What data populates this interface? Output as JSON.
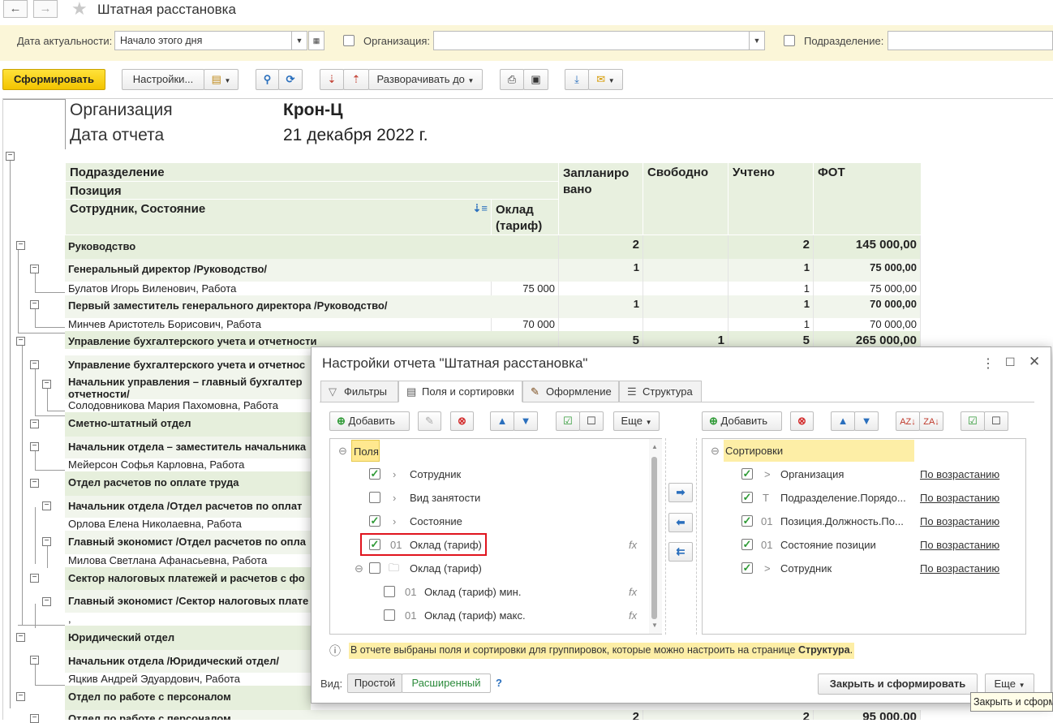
{
  "window": {
    "title": "Штатная расстановка"
  },
  "filters": {
    "date_label": "Дата актуальности:",
    "date_value": "Начало этого дня",
    "org_label": "Организация:",
    "org_value": "",
    "dept_label": "Подразделение:",
    "dept_value": ""
  },
  "toolbar": {
    "generate": "Сформировать",
    "settings": "Настройки...",
    "expand_to": "Разворачивать до"
  },
  "report": {
    "org_label": "Организация",
    "org_value": "Крон-Ц",
    "date_label": "Дата отчета",
    "date_value": "21 декабря 2022 г.",
    "headers": {
      "dept": "Подразделение",
      "position": "Позиция",
      "employee": "Сотрудник, Состояние",
      "salary": "Оклад (тариф)",
      "planned": "Запланиро вано",
      "free": "Свободно",
      "counted": "Учтено",
      "fot": "ФОТ"
    },
    "rows": [
      {
        "name": "Руководство",
        "salary": "",
        "planned": "2",
        "free": "",
        "counted": "2",
        "fot": "145 000,00"
      },
      {
        "name": "Генеральный директор /Руководство/",
        "salary": "",
        "planned": "1",
        "free": "",
        "counted": "1",
        "fot": "75 000,00"
      },
      {
        "name": "Булатов Игорь Виленович, Работа",
        "salary": "75 000",
        "planned": "",
        "free": "",
        "counted": "1",
        "fot": "75 000,00"
      },
      {
        "name": "Первый заместитель генерального директора /Руководство/",
        "salary": "",
        "planned": "1",
        "free": "",
        "counted": "1",
        "fot": "70 000,00"
      },
      {
        "name": "Минчев Аристотель Борисович, Работа",
        "salary": "70 000",
        "planned": "",
        "free": "",
        "counted": "1",
        "fot": "70 000,00"
      },
      {
        "name": "Управление бухгалтерского учета и отчетности",
        "salary": "",
        "planned": "5",
        "free": "1",
        "counted": "5",
        "fot": "265 000,00"
      },
      {
        "name": "Управление бухгалтерского учета и отчетнос"
      },
      {
        "name": "Начальник управления – главный бухгалтер",
        "name2": "отчетности/"
      },
      {
        "name": "Солодовникова Мария Пахомовна, Работа"
      },
      {
        "name": "Сметно-штатный отдел"
      },
      {
        "name": "Начальник отдела – заместитель начальника"
      },
      {
        "name": "Мейерсон Софья Карловна, Работа"
      },
      {
        "name": "Отдел расчетов по оплате труда"
      },
      {
        "name": "Начальник отдела /Отдел расчетов по оплат"
      },
      {
        "name": "Орлова Елена Николаевна, Работа"
      },
      {
        "name": "Главный экономист /Отдел расчетов по опла"
      },
      {
        "name": "Милова Светлана Афанасьевна, Работа"
      },
      {
        "name": "Сектор налоговых платежей и расчетов с фо"
      },
      {
        "name": "Главный экономист /Сектор налоговых плате"
      },
      {
        "name": ","
      },
      {
        "name": "Юридический отдел"
      },
      {
        "name": "Начальник отдела /Юридический отдел/"
      },
      {
        "name": "Яцкив Андрей Эдуардович, Работа"
      },
      {
        "name": "Отдел по работе с персоналом"
      },
      {
        "name": "Отдел по работе с персоналом",
        "salary": "",
        "planned": "2",
        "free": "",
        "counted": "2",
        "fot": "95 000,00"
      }
    ]
  },
  "dialog": {
    "title": "Настройки отчета \"Штатная расстановка\"",
    "tabs": [
      "Фильтры",
      "Поля и сортировки",
      "Оформление",
      "Структура"
    ],
    "left": {
      "add": "Добавить",
      "more": "Еще",
      "root": "Поля",
      "items": [
        {
          "prefix": ">",
          "label": "Сотрудник",
          "checked": true
        },
        {
          "prefix": ">",
          "label": "Вид занятости",
          "checked": false
        },
        {
          "prefix": ">",
          "label": "Состояние",
          "checked": true
        },
        {
          "prefix": "01",
          "label": "Оклад (тариф)",
          "checked": true
        },
        {
          "prefix": "",
          "label": "Оклад (тариф)",
          "checked": false
        },
        {
          "prefix": "01",
          "label": "Оклад (тариф) мин.",
          "checked": false
        },
        {
          "prefix": "01",
          "label": "Оклад (тариф) макс.",
          "checked": false
        }
      ]
    },
    "right": {
      "add": "Добавить",
      "root": "Сортировки",
      "items": [
        {
          "prefix": ">",
          "label": "Организация",
          "order": "По возрастанию"
        },
        {
          "prefix": "T",
          "label": "Подразделение.Порядо...",
          "order": "По возрастанию"
        },
        {
          "prefix": "01",
          "label": "Позиция.Должность.По...",
          "order": "По возрастанию"
        },
        {
          "prefix": "01",
          "label": "Состояние позиции",
          "order": "По возрастанию"
        },
        {
          "prefix": ">",
          "label": "Сотрудник",
          "order": "По возрастанию"
        }
      ]
    },
    "info_text": "В отчете выбраны поля и сортировки для группировок, которые можно настроить на странице ",
    "info_link": "Структура",
    "info_end": ".",
    "view_label": "Вид:",
    "view_simple": "Простой",
    "view_extended": "Расширенный",
    "help": "?",
    "close_generate": "Закрыть и сформировать",
    "more": "Еще"
  },
  "tooltip": "Закрыть и сформ"
}
